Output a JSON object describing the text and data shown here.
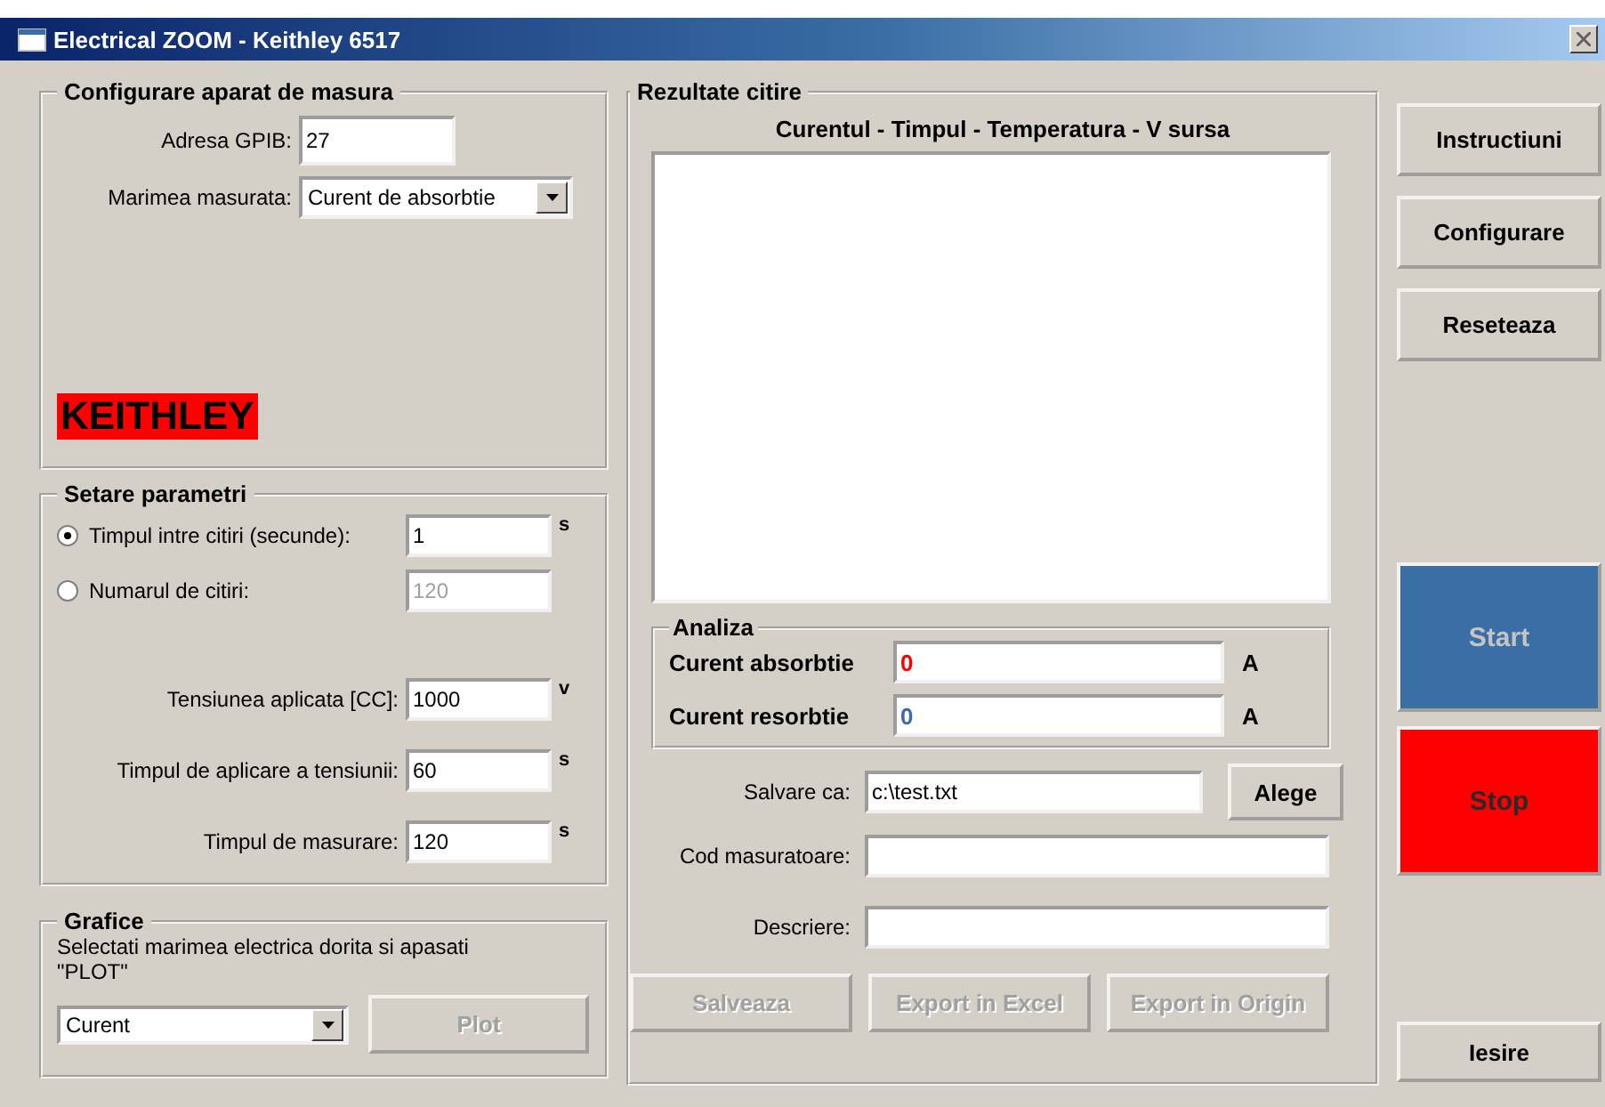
{
  "window": {
    "title": "Electrical ZOOM - Keithley 6517"
  },
  "configure": {
    "title": "Configurare aparat de masura",
    "gpib": {
      "label": "Adresa GPIB:",
      "value": "27"
    },
    "measure": {
      "label": "Marimea masurata:",
      "value": "Curent de absorbtie"
    },
    "logo": "KEITHLEY"
  },
  "parameters": {
    "title": "Setare parametri",
    "modes": [
      {
        "label": "Timpul intre citiri (secunde):",
        "selected": true,
        "value": "1",
        "unit": "s",
        "disabled": false
      },
      {
        "label": "Numarul de citiri:",
        "selected": false,
        "value": "120",
        "disabled": true
      }
    ],
    "fields": [
      {
        "label": "Tensiunea aplicata [CC]:",
        "value": "1000",
        "unit": "v"
      },
      {
        "label": "Timpul de aplicare a tensiunii:",
        "value": "60",
        "unit": "s"
      },
      {
        "label": "Timpul de masurare:",
        "value": "120",
        "unit": "s"
      }
    ]
  },
  "graphs": {
    "title": "Grafice",
    "hint": "Selectati marimea electrica dorita si apasati \"PLOT\"",
    "select_value": "Curent",
    "plot": {
      "label": "Plot",
      "disabled": true
    }
  },
  "results": {
    "title": "Rezultate citire",
    "list_header": "Curentul - Timpul - Temperatura - V sursa",
    "analysis": {
      "title": "Analiza",
      "rows": [
        {
          "label": "Curent absorbtie",
          "value": "0",
          "unit": "A",
          "color": "#ff0000"
        },
        {
          "label": "Curent resorbtie",
          "value": "0",
          "unit": "A",
          "color": "#3a6ea5"
        }
      ]
    },
    "save_as": {
      "label": "Salvare ca:",
      "value": "c:\\test.txt",
      "button": "Alege"
    },
    "code": {
      "label": "Cod masuratoare:"
    },
    "description": {
      "label": "Descriere:"
    },
    "buttons": [
      {
        "label": "Salveaza",
        "disabled": true
      },
      {
        "label": "Export in Excel",
        "disabled": true
      },
      {
        "label": "Export in Origin",
        "disabled": true
      }
    ]
  },
  "side_buttons": [
    {
      "label": "Instructiuni",
      "kind": "normal",
      "disabled": false
    },
    {
      "label": "Configurare",
      "kind": "normal",
      "disabled": false
    },
    {
      "label": "Reseteaza",
      "kind": "normal",
      "disabled": false
    },
    {
      "label": "Start",
      "kind": "big",
      "color": "#3a6ea5",
      "disabled": true
    },
    {
      "label": "Stop",
      "kind": "big",
      "color": "#ff0000",
      "disabled": true
    },
    {
      "label": "Iesire",
      "kind": "bottom",
      "disabled": false
    }
  ]
}
